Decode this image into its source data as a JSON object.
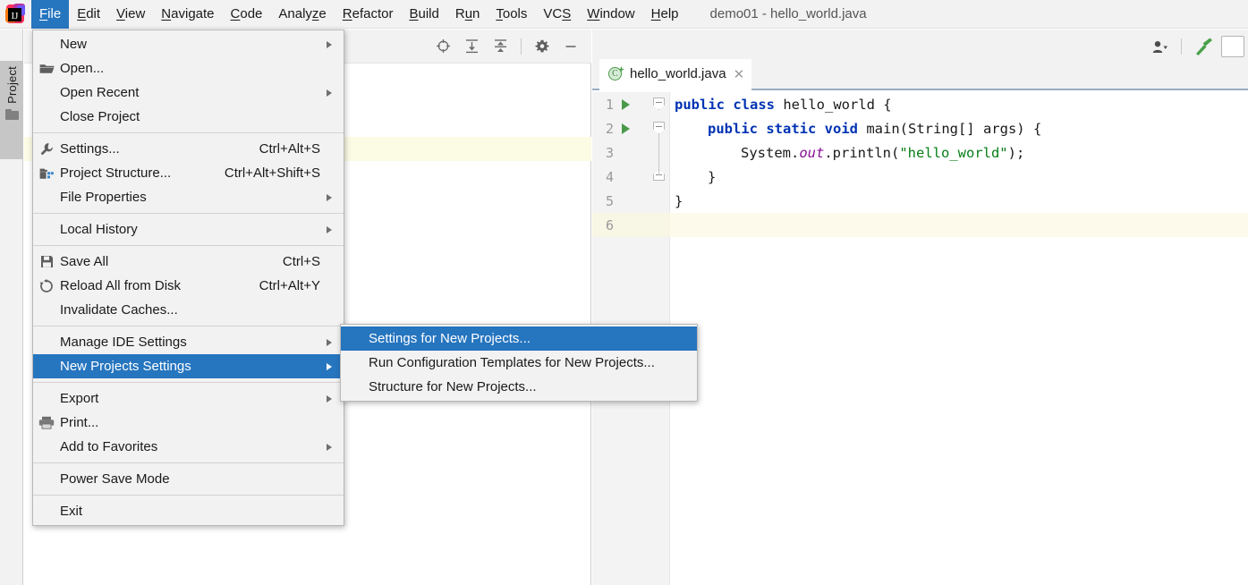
{
  "window": {
    "title": "demo01 - hello_world.java",
    "logo_icon": "intellij-idea-logo"
  },
  "menubar": {
    "items": [
      {
        "label": "File",
        "mnemonic": "F",
        "active": true
      },
      {
        "label": "Edit",
        "mnemonic": "E",
        "active": false
      },
      {
        "label": "View",
        "mnemonic": "V",
        "active": false
      },
      {
        "label": "Navigate",
        "mnemonic": "N",
        "active": false
      },
      {
        "label": "Code",
        "mnemonic": "C",
        "active": false
      },
      {
        "label": "Analyze",
        "mnemonic": "z",
        "active": false
      },
      {
        "label": "Refactor",
        "mnemonic": "R",
        "active": false
      },
      {
        "label": "Build",
        "mnemonic": "B",
        "active": false
      },
      {
        "label": "Run",
        "mnemonic": "u",
        "active": false
      },
      {
        "label": "Tools",
        "mnemonic": "T",
        "active": false
      },
      {
        "label": "VCS",
        "mnemonic": "S",
        "active": false
      },
      {
        "label": "Window",
        "mnemonic": "W",
        "active": false
      },
      {
        "label": "Help",
        "mnemonic": "H",
        "active": false
      }
    ]
  },
  "file_menu": {
    "groups": [
      [
        {
          "label": "New",
          "icon": "",
          "accel": "",
          "submenu": true,
          "selected": false
        },
        {
          "label": "Open...",
          "icon": "folder-open-icon",
          "accel": "",
          "submenu": false,
          "selected": false
        },
        {
          "label": "Open Recent",
          "icon": "",
          "accel": "",
          "submenu": true,
          "selected": false
        },
        {
          "label": "Close Project",
          "icon": "",
          "accel": "",
          "submenu": false,
          "selected": false
        }
      ],
      [
        {
          "label": "Settings...",
          "icon": "wrench-icon",
          "accel": "Ctrl+Alt+S",
          "submenu": false,
          "selected": false
        },
        {
          "label": "Project Structure...",
          "icon": "structure-icon",
          "accel": "Ctrl+Alt+Shift+S",
          "submenu": false,
          "selected": false
        },
        {
          "label": "File Properties",
          "icon": "",
          "accel": "",
          "submenu": true,
          "selected": false
        }
      ],
      [
        {
          "label": "Local History",
          "icon": "",
          "accel": "",
          "submenu": true,
          "selected": false
        }
      ],
      [
        {
          "label": "Save All",
          "icon": "save-icon",
          "accel": "Ctrl+S",
          "submenu": false,
          "selected": false
        },
        {
          "label": "Reload All from Disk",
          "icon": "reload-icon",
          "accel": "Ctrl+Alt+Y",
          "submenu": false,
          "selected": false
        },
        {
          "label": "Invalidate Caches...",
          "icon": "",
          "accel": "",
          "submenu": false,
          "selected": false
        }
      ],
      [
        {
          "label": "Manage IDE Settings",
          "icon": "",
          "accel": "",
          "submenu": true,
          "selected": false
        },
        {
          "label": "New Projects Settings",
          "icon": "",
          "accel": "",
          "submenu": true,
          "selected": true
        }
      ],
      [
        {
          "label": "Export",
          "icon": "",
          "accel": "",
          "submenu": true,
          "selected": false
        },
        {
          "label": "Print...",
          "icon": "print-icon",
          "accel": "",
          "submenu": false,
          "selected": false
        },
        {
          "label": "Add to Favorites",
          "icon": "",
          "accel": "",
          "submenu": true,
          "selected": false
        }
      ],
      [
        {
          "label": "Power Save Mode",
          "icon": "",
          "accel": "",
          "submenu": false,
          "selected": false
        }
      ],
      [
        {
          "label": "Exit",
          "icon": "",
          "accel": "",
          "submenu": false,
          "selected": false
        }
      ]
    ]
  },
  "new_projects_submenu": {
    "items": [
      {
        "label": "Settings for New Projects...",
        "selected": true
      },
      {
        "label": "Run Configuration Templates for New Projects...",
        "selected": false
      },
      {
        "label": "Structure for New Projects...",
        "selected": false
      }
    ]
  },
  "tool_strip": {
    "project_tab_label": "Project",
    "project_tab_icon": "folder-icon"
  },
  "project_panel": {
    "toolbar_icons": [
      "locate-target-icon",
      "expand-all-icon",
      "collapse-all-icon",
      "gear-icon",
      "hide-panel-icon"
    ]
  },
  "toolbar_right": {
    "icons": [
      "user-account-icon",
      "chevron-down-icon",
      "build-hammer-icon",
      "search-everywhere-icon"
    ],
    "build_icon_color": "#4aa04a"
  },
  "editor": {
    "tab": {
      "label": "hello_world.java",
      "file_icon": "java-class-icon",
      "close_icon": "close-icon"
    },
    "lines": [
      {
        "no": "1",
        "run_marker": true,
        "fold": "open",
        "indent": 0,
        "caret": false,
        "tokens": [
          {
            "t": "public ",
            "c": "kw"
          },
          {
            "t": "class ",
            "c": "kw"
          },
          {
            "t": "hello_world {",
            "c": "plain"
          }
        ]
      },
      {
        "no": "2",
        "run_marker": true,
        "fold": "open",
        "indent": 1,
        "caret": false,
        "tokens": [
          {
            "t": "public ",
            "c": "kw"
          },
          {
            "t": "static ",
            "c": "kw"
          },
          {
            "t": "void ",
            "c": "kw"
          },
          {
            "t": "main",
            "c": "mth"
          },
          {
            "t": "(String[] args) {",
            "c": "plain"
          }
        ]
      },
      {
        "no": "3",
        "run_marker": false,
        "fold": "",
        "indent": 2,
        "caret": false,
        "tokens": [
          {
            "t": "System.",
            "c": "plain"
          },
          {
            "t": "out",
            "c": "fld"
          },
          {
            "t": ".println(",
            "c": "plain"
          },
          {
            "t": "\"hello_world\"",
            "c": "str"
          },
          {
            "t": ");",
            "c": "plain"
          }
        ]
      },
      {
        "no": "4",
        "run_marker": false,
        "fold": "close",
        "indent": 1,
        "caret": false,
        "tokens": [
          {
            "t": "}",
            "c": "plain"
          }
        ]
      },
      {
        "no": "5",
        "run_marker": false,
        "fold": "",
        "indent": 0,
        "caret": false,
        "tokens": [
          {
            "t": "}",
            "c": "plain"
          }
        ]
      },
      {
        "no": "6",
        "run_marker": false,
        "fold": "",
        "indent": 0,
        "caret": true,
        "tokens": []
      }
    ]
  },
  "colors": {
    "accent_selection": "#2675bf",
    "menubar_bg": "#f2f2f2",
    "menu_bg": "#f2f2f2",
    "keyword": "#0033b3",
    "string": "#067d17",
    "field": "#871094",
    "caret_line": "#fdfaec",
    "selected_file_row": "#fcfbe4"
  }
}
